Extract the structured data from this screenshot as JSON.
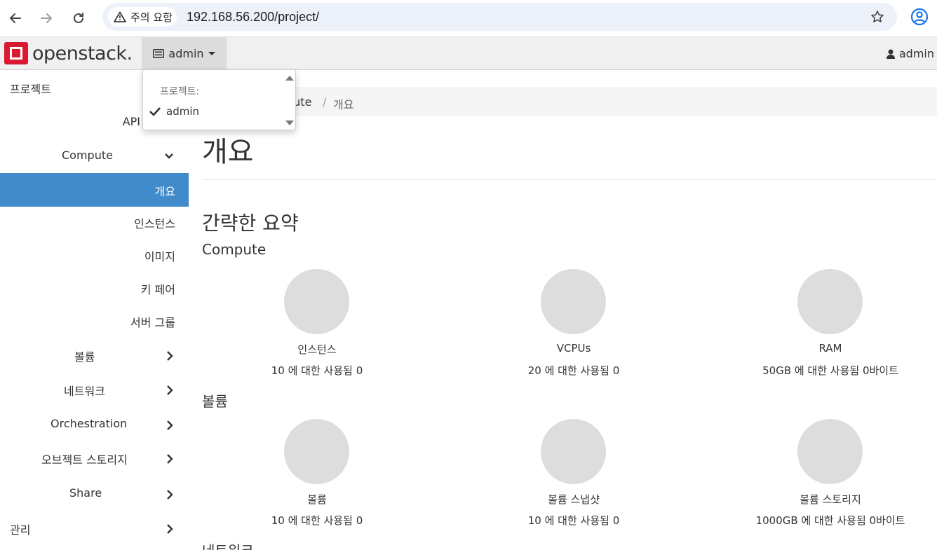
{
  "browser": {
    "security_label": "주의 요함",
    "url": "192.168.56.200/project/"
  },
  "header": {
    "brand": "openstack.",
    "project_switcher": "admin",
    "user": "admin"
  },
  "dropdown": {
    "header": "프로젝트:",
    "items": [
      "admin"
    ]
  },
  "sidebar": {
    "section": "프로젝트",
    "api": "API",
    "compute": "Compute",
    "compute_items": [
      "개요",
      "인스턴스",
      "이미지",
      "키 페어",
      "서버 그룹"
    ],
    "groups": [
      "볼륨",
      "네트워크",
      "Orchestration",
      "오브젝트 스토리지",
      "Share"
    ],
    "admin_section": "관리"
  },
  "breadcrumb": {
    "items": [
      "pute",
      "개요"
    ],
    "separator": "/"
  },
  "main": {
    "title": "개요",
    "summary_heading": "간략한 요약",
    "compute_heading": "Compute",
    "volume_heading": "볼륨",
    "network_heading": "네트워크",
    "compute_charts": [
      {
        "label": "인스턴스",
        "usage": "10 에 대한 사용됨 0"
      },
      {
        "label": "VCPUs",
        "usage": "20 에 대한 사용됨 0"
      },
      {
        "label": "RAM",
        "usage": "50GB 에 대한 사용됨 0바이트"
      }
    ],
    "volume_charts": [
      {
        "label": "볼륨",
        "usage": "10 에 대한 사용됨 0"
      },
      {
        "label": "볼륨 스냅샷",
        "usage": "10 에 대한 사용됨 0"
      },
      {
        "label": "볼륨 스토리지",
        "usage": "1000GB 에 대한 사용됨 0바이트"
      }
    ]
  },
  "colors": {
    "accent": "#428bca",
    "logo_red": "#da1a32",
    "pie_gray": "#dddddd"
  },
  "icons": [
    "back-icon",
    "forward-icon",
    "reload-icon",
    "warning-icon",
    "star-icon",
    "profile-icon",
    "openstack-logo-icon",
    "server-icon",
    "user-icon",
    "check-icon",
    "chevron-down-icon",
    "chevron-right-icon"
  ]
}
